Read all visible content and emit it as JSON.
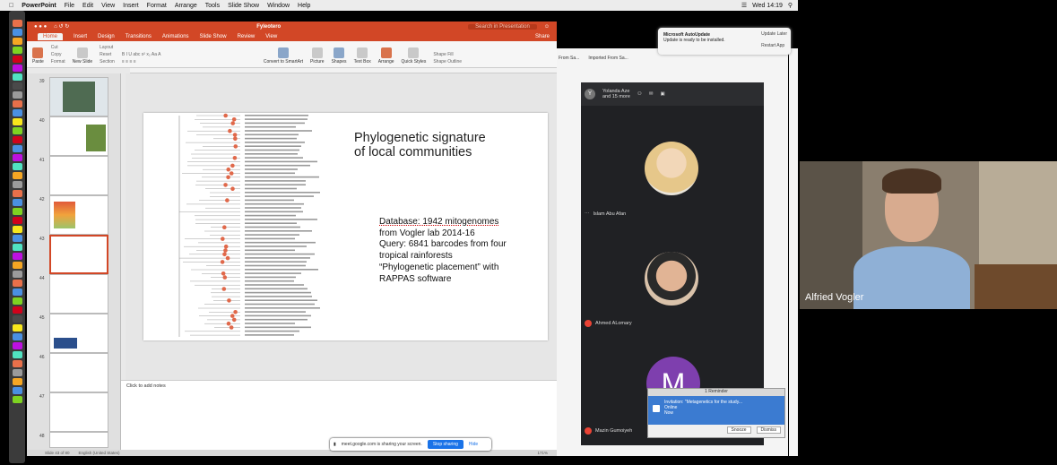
{
  "menubar": {
    "app": "PowerPoint",
    "items": [
      "File",
      "Edit",
      "View",
      "Insert",
      "Format",
      "Arrange",
      "Tools",
      "Slide Show",
      "Window",
      "Help"
    ],
    "clock": "Wed 14:19"
  },
  "ppt": {
    "doc_title": "Fyleotero",
    "search_placeholder": "Search in Presentation",
    "tabs": [
      "Home",
      "Insert",
      "Design",
      "Transitions",
      "Animations",
      "Slide Show",
      "Review",
      "View"
    ],
    "active_tab": "Home",
    "share": "Share",
    "ribbon": {
      "paste": "Paste",
      "cut": "Cut",
      "copy": "Copy",
      "format": "Format",
      "new_slide": "New Slide",
      "layout": "Layout",
      "reset": "Reset",
      "section": "Section",
      "convert": "Convert to SmartArt",
      "picture": "Picture",
      "shapes": "Shapes",
      "textbox": "Text Box",
      "arrange": "Arrange",
      "quick_styles": "Quick Styles",
      "shape_fill": "Shape Fill",
      "shape_outline": "Shape Outline"
    },
    "slide_numbers": [
      "39",
      "40",
      "41",
      "42",
      "43",
      "44",
      "45",
      "46",
      "47",
      "48"
    ],
    "slide": {
      "title_line1": "Phylogenetic signature",
      "title_line2": "of local communities",
      "body": [
        "Database: 1942 mitogenomes",
        "from Vogler lab 2014-16",
        "Query: 6841 barcodes from four",
        "tropical rainforests",
        "“Phylogenetic placement” with",
        "RAPPAS software"
      ]
    },
    "notes_placeholder": "Click to add notes",
    "status_left": "Slide 43 of 80",
    "status_lang": "English (United States)",
    "zoom": "171%"
  },
  "share_bar": {
    "message": "meet.google.com is sharing your screen.",
    "stop": "Stop sharing",
    "hide": "Hide"
  },
  "background_window": {
    "item1": "From Sa...",
    "item2": "Imported From Sa..."
  },
  "meet": {
    "header_avatar": "Y",
    "header_text1": "Yolanda Aze",
    "header_text2": "and 15 more",
    "participants": [
      {
        "name": "Islam Abu Afan"
      },
      {
        "name": "Ahmed ALomary"
      },
      {
        "name": "Mazin Gumoiyeh",
        "initial": "M"
      }
    ]
  },
  "autoupdate": {
    "title": "Microsoft AutoUpdate",
    "message": "Update is ready to be installed.",
    "update_later": "Update Later",
    "restart": "Restart App"
  },
  "reminder": {
    "header": "1 Reminder",
    "title": "Invitation: \"Metagenetics for the study...",
    "line2": "Online",
    "line3": "Now",
    "snooze": "Snooze",
    "dismiss": "Dismiss"
  },
  "video": {
    "name": "Alfried Vogler"
  }
}
